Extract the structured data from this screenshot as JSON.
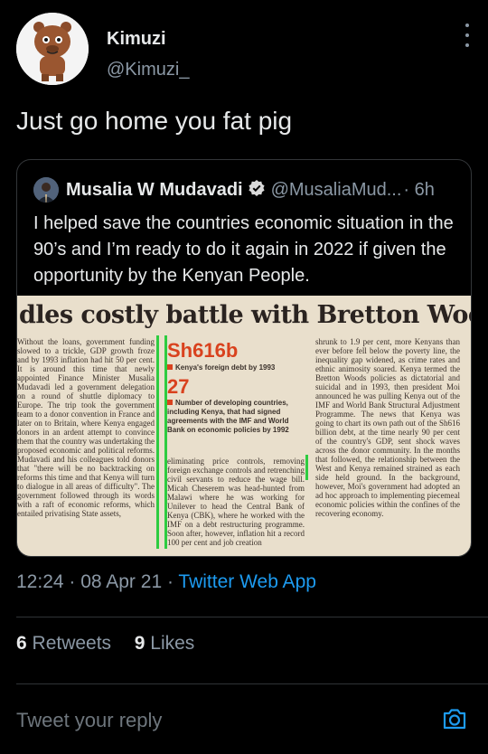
{
  "author": {
    "name": "Kimuzi",
    "handle": "@Kimuzi_"
  },
  "tweet": {
    "text": "Just go home you fat pig"
  },
  "quoted": {
    "name": "Musalia W Mudavadi",
    "handle": "@MusaliaMud...",
    "time": "· 6h",
    "text": "I helped save the countries economic situation in the 90’s and I’m ready to do it again in 2022 if given the opportunity by the Kenyan People.",
    "clipping": {
      "headline": "dles costly battle with Bretton Woods ins",
      "stat1_value": "Sh616b",
      "stat1_caption": "Kenya's foreign debt by 1993",
      "stat2_value": "27",
      "stat2_caption": "Number of developing countries, including Kenya, that had signed agreements with the IMF and World Bank on economic policies by 1992",
      "col1": "Without the loans, government funding slowed to a trickle, GDP growth froze and by 1993 inflation had hit 50 per cent. It is around this time that newly appointed Finance Minister Musalia Mudavadi led a government delegation on a round of shuttle diplomacy to Europe. The trip took the government team to a donor convention in France and later on to Britain, where Kenya engaged donors in an ardent attempt to convince them that the country was undertaking the proposed economic and political reforms. Mudavadi and his colleagues told donors that \"there will be no backtracking on reforms this time and that Kenya will turn to dialogue in all areas of difficulty\". The government followed through its words with a raft of economic reforms, which entailed privatising State assets,",
      "col2": "eliminating price controls, removing foreign exchange controls and retrenching civil servants to reduce the wage bill. Micah Cheserem was head-hunted from Malawi where he was working for Unilever to head the Central Bank of Kenya (CBK), where he worked with the IMF on a debt restructuring programme. Soon after, however, inflation hit a record 100 per cent and job creation",
      "col3": "shrunk to 1.9 per cent, more Kenyans than ever before fell below the poverty line, the inequality gap widened, as crime rates and ethnic animosity soared. Kenya termed the Bretton Woods policies as dictatorial and suicidal and in 1993, then president Moi announced he was pulling Kenya out of the IMF and World Bank Structural Adjustment Programme. The news that Kenya was going to chart its own path out of the Sh616 billion debt, at the time nearly 90 per cent of the country's GDP, sent shock waves across the donor community. In the months that followed, the relationship between the West and Kenya remained strained as each side held ground. In the background, however, Moi's government had adopted an ad hoc approach to implementing piecemeal economic policies within the confines of the recovering economy."
    }
  },
  "meta": {
    "time": "12:24 · 08 Apr 21 · ",
    "app": "Twitter Web App"
  },
  "stats": {
    "retweets_count": "6",
    "retweets_label": " Retweets",
    "likes_count": "9",
    "likes_label": " Likes"
  },
  "reply": {
    "placeholder": "Tweet your reply"
  },
  "colors": {
    "background": "#000000",
    "link": "#1d9bf0",
    "secondary_text": "#8b98a5"
  },
  "icons": [
    "more-options-icon",
    "verified-badge-icon",
    "camera-icon"
  ]
}
